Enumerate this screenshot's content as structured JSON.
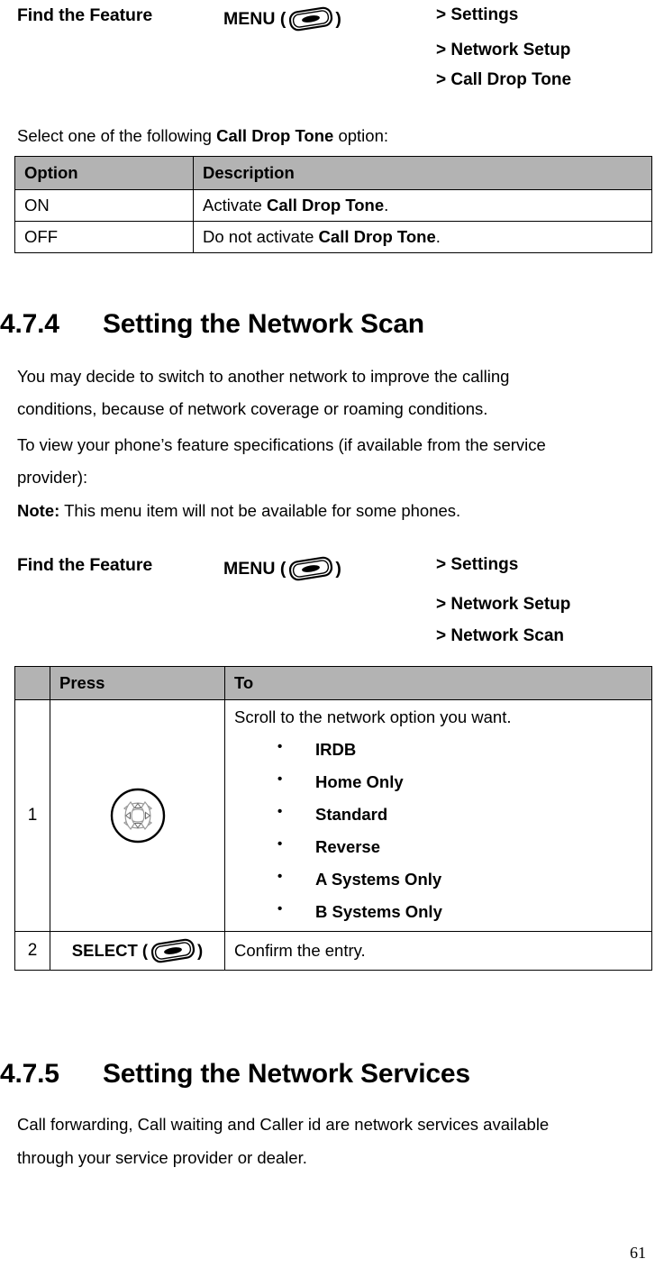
{
  "find_feature_1": {
    "label": "Find the Feature",
    "menu_prefix": "MENU (",
    "menu_suffix": ")",
    "path": [
      "> Settings",
      "> Network Setup",
      "> Call Drop Tone"
    ]
  },
  "intro_line": {
    "before": "Select one of the following ",
    "bold": "Call Drop Tone",
    "after": " option:"
  },
  "option_table": {
    "headers": [
      "Option",
      "Description"
    ],
    "rows": [
      {
        "option": "ON",
        "desc_before": "Activate ",
        "desc_bold": "Call Drop Tone",
        "desc_after": "."
      },
      {
        "option": "OFF",
        "desc_before": "Do not activate ",
        "desc_bold": "Call Drop Tone",
        "desc_after": "."
      }
    ]
  },
  "section_474": {
    "number": "4.7.4",
    "title": "Setting the Network Scan",
    "paragraphs": [
      "You may decide to switch to another network to improve the calling",
      "conditions, because of network coverage or roaming conditions.",
      "To view your phone’s feature specifications (if available from the service",
      "provider):"
    ],
    "note_label": "Note:",
    "note_text": " This menu item will not be available for some phones."
  },
  "find_feature_2": {
    "label": "Find the Feature",
    "menu_prefix": "MENU (",
    "menu_suffix": ")",
    "path": [
      "> Settings",
      "> Network Setup",
      "> Network Scan"
    ]
  },
  "steps_table": {
    "headers": [
      "",
      "Press",
      "To"
    ],
    "rows": [
      {
        "num": "1",
        "press_icon": "navigation-key-icon",
        "to_lead": "Scroll to the network option you want.",
        "to_list": [
          "IRDB",
          "Home Only",
          "Standard",
          "Reverse",
          "A Systems Only",
          "B Systems Only"
        ]
      },
      {
        "num": "2",
        "press_label_prefix": "SELECT (",
        "press_label_suffix": ")",
        "press_icon": "menu-key-icon",
        "to_lead": "Confirm the entry."
      }
    ]
  },
  "section_475": {
    "number": "4.7.5",
    "title": "Setting the Network Services",
    "paragraphs": [
      "Call forwarding, Call waiting and Caller id are network services available",
      "through your service provider or dealer."
    ]
  },
  "footer": {
    "page_number": "61"
  },
  "colors": {
    "table_header_gray": "#b3b3b3",
    "border": "#000000",
    "text": "#000000"
  }
}
